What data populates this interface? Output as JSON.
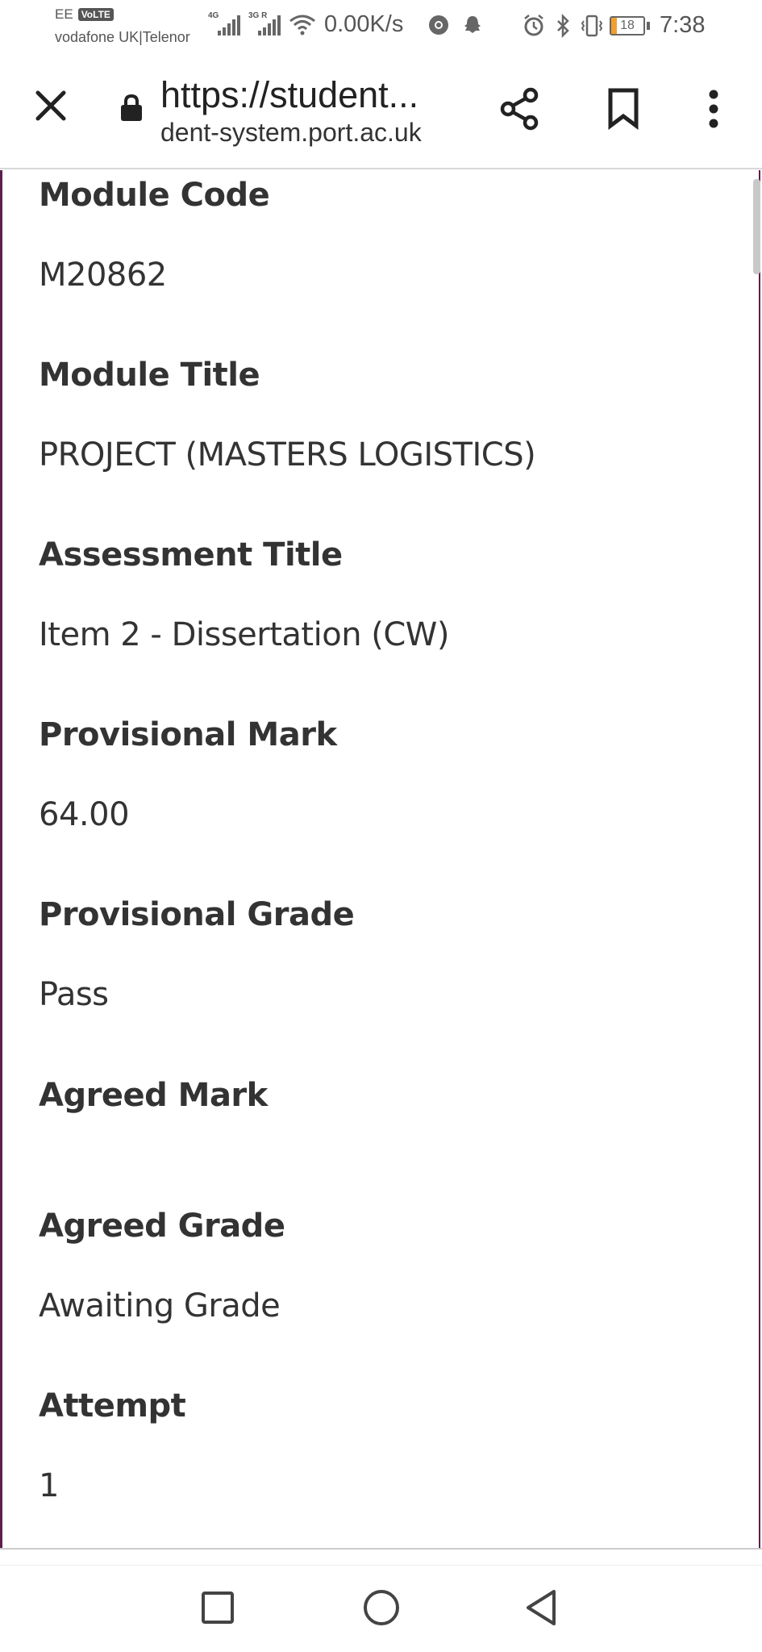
{
  "status_bar": {
    "carrier_primary": "EE",
    "volte_badge": "VoLTE",
    "carrier_secondary": "vodafone UK|Telenor",
    "network_1": "4G",
    "network_2": "3G R",
    "speed": "0.00K/s",
    "battery_level": "18",
    "time": "7:38",
    "icons": [
      "signal-icon",
      "wifi-icon",
      "chrome-icon",
      "snapchat-icon",
      "alarm-icon",
      "bluetooth-icon",
      "vibrate-icon",
      "battery-icon"
    ],
    "battery_color": "#f0a030"
  },
  "browser": {
    "page_title": "https://student...",
    "url_host": "dent-system.port.ac.uk",
    "icons": [
      "close-icon",
      "lock-icon",
      "share-icon",
      "bookmark-icon",
      "more-vert-icon"
    ]
  },
  "details": {
    "module_code_label": "Module Code",
    "module_code_value": "M20862",
    "module_title_label": "Module Title",
    "module_title_value": "PROJECT (MASTERS LOGISTICS)",
    "assessment_title_label": "Assessment Title",
    "assessment_title_value": "Item 2 - Dissertation (CW)",
    "provisional_mark_label": "Provisional Mark",
    "provisional_mark_value": "64.00",
    "provisional_grade_label": "Provisional Grade",
    "provisional_grade_value": "Pass",
    "agreed_mark_label": "Agreed Mark",
    "agreed_mark_value": "",
    "agreed_grade_label": "Agreed Grade",
    "agreed_grade_value": "Awaiting Grade",
    "attempt_label": "Attempt",
    "attempt_value": "1"
  },
  "theme": {
    "frame_color": "#5b1f4d",
    "text_color": "#333333"
  },
  "nav_bar": {
    "icons": [
      "recent-apps-icon",
      "home-icon",
      "back-icon"
    ]
  }
}
